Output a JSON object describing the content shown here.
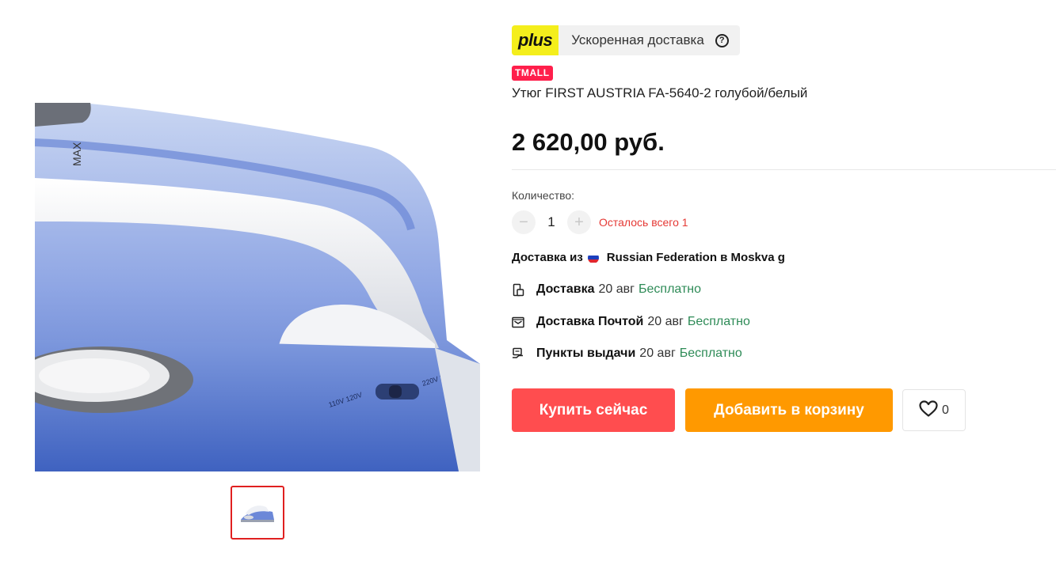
{
  "plus": {
    "logo": "plus",
    "label": "Ускоренная доставка",
    "help_icon": "question-circle-icon",
    "logo_color": "#f4ee1c"
  },
  "badge": {
    "text": "TMALL",
    "color": "#ff1f4b"
  },
  "product": {
    "title": "Утюг FIRST AUSTRIA FA-5640-2 голубой/белый",
    "price": "2 620,00 руб."
  },
  "quantity": {
    "label": "Количество:",
    "minus": "−",
    "value": "1",
    "plus": "+",
    "stock_note": "Осталось всего 1"
  },
  "shipping": {
    "from_prefix": "Доставка из",
    "flag_icon": "russia-flag-icon",
    "from_location": "Russian Federation в Moskva g",
    "options": [
      {
        "icon": "courier-box-icon",
        "name": "Доставка",
        "date": "20 авг",
        "price": "Бесплатно"
      },
      {
        "icon": "post-office-icon",
        "name": "Доставка Почтой",
        "date": "20 авг",
        "price": "Бесплатно"
      },
      {
        "icon": "pickup-point-icon",
        "name": "Пункты выдачи",
        "date": "20 авг",
        "price": "Бесплатно"
      }
    ]
  },
  "actions": {
    "buy_now": "Купить сейчас",
    "add_to_cart": "Добавить в корзину",
    "wishlist_icon": "heart-icon",
    "wishlist_count": "0"
  },
  "colors": {
    "buy_button": "#ff4d4f",
    "cart_button": "#ff9900",
    "free_price": "#2e8b57",
    "stock_note": "#e53935"
  },
  "gallery": {
    "main_image": "iron-product-image",
    "thumbnail": "iron-thumbnail-image"
  }
}
